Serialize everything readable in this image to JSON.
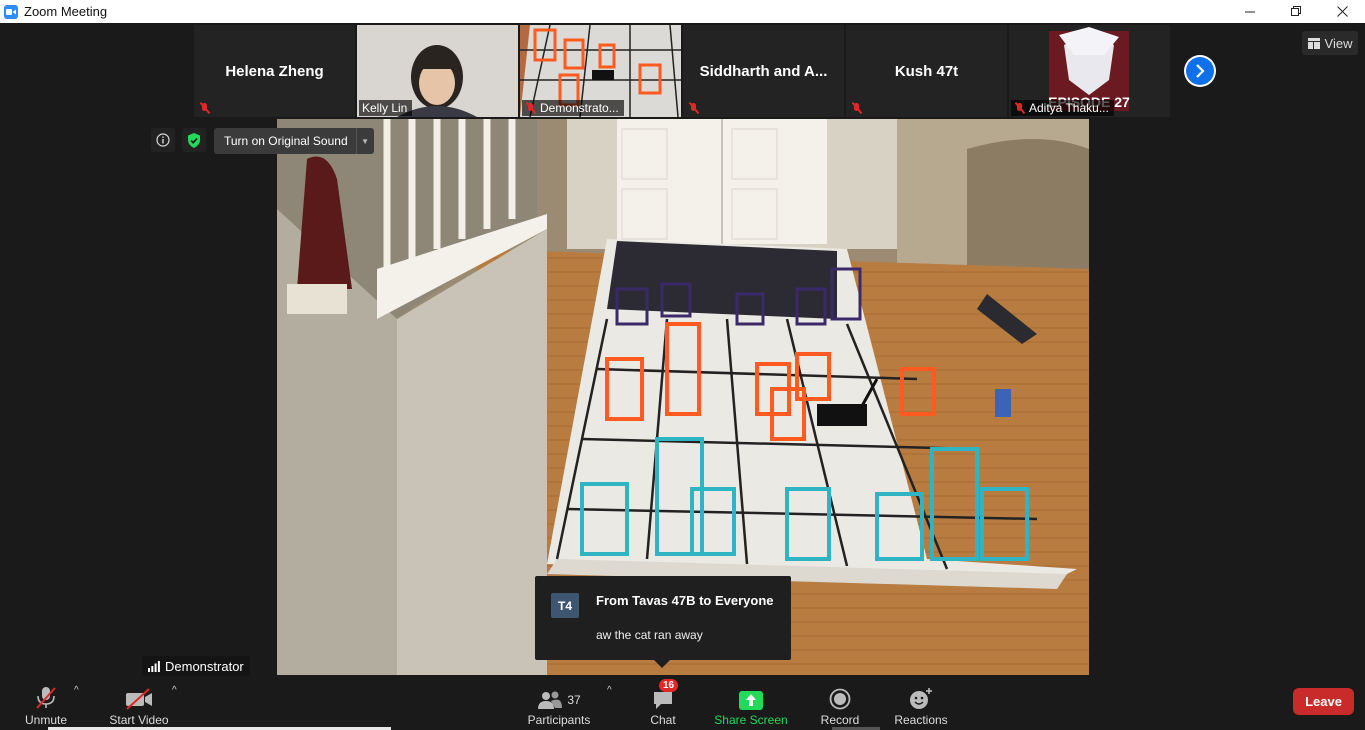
{
  "window": {
    "title": "Zoom Meeting",
    "minimize_icon": "minimize-icon",
    "restore_icon": "restore-icon",
    "close_icon": "close-icon"
  },
  "gallery": {
    "tiles": [
      {
        "name": "Helena Zheng",
        "type": "name-only",
        "muted": true
      },
      {
        "name": "Kelly Lin",
        "type": "video",
        "muted": false
      },
      {
        "name": "Demonstrato...",
        "type": "video",
        "muted": true
      },
      {
        "name": "Siddharth  and  A...",
        "type": "name-only",
        "muted": true
      },
      {
        "name": "Kush 47t",
        "type": "name-only",
        "muted": true
      },
      {
        "name": "Aditya Thaku...",
        "type": "picture",
        "muted": true,
        "picture_text": "EPISODE 27"
      }
    ],
    "next_page_icon": "chevron-right-icon"
  },
  "view_button": {
    "label": "View"
  },
  "overlay": {
    "original_sound_label": "Turn on Original Sound",
    "shield_color": "#23d959"
  },
  "active_speaker": {
    "name": "Demonstrator"
  },
  "chat_toast": {
    "avatar_initials": "T4",
    "from": "From Tavas 47B to Everyone",
    "message": "aw the cat ran away"
  },
  "toolbar": {
    "unmute_label": "Unmute",
    "start_video_label": "Start Video",
    "participants_label": "Participants",
    "participants_count": "37",
    "chat_label": "Chat",
    "chat_badge": "16",
    "share_label": "Share Screen",
    "record_label": "Record",
    "reactions_label": "Reactions",
    "leave_label": "Leave",
    "share_color": "#23d959",
    "leave_color": "#c92b2b"
  }
}
